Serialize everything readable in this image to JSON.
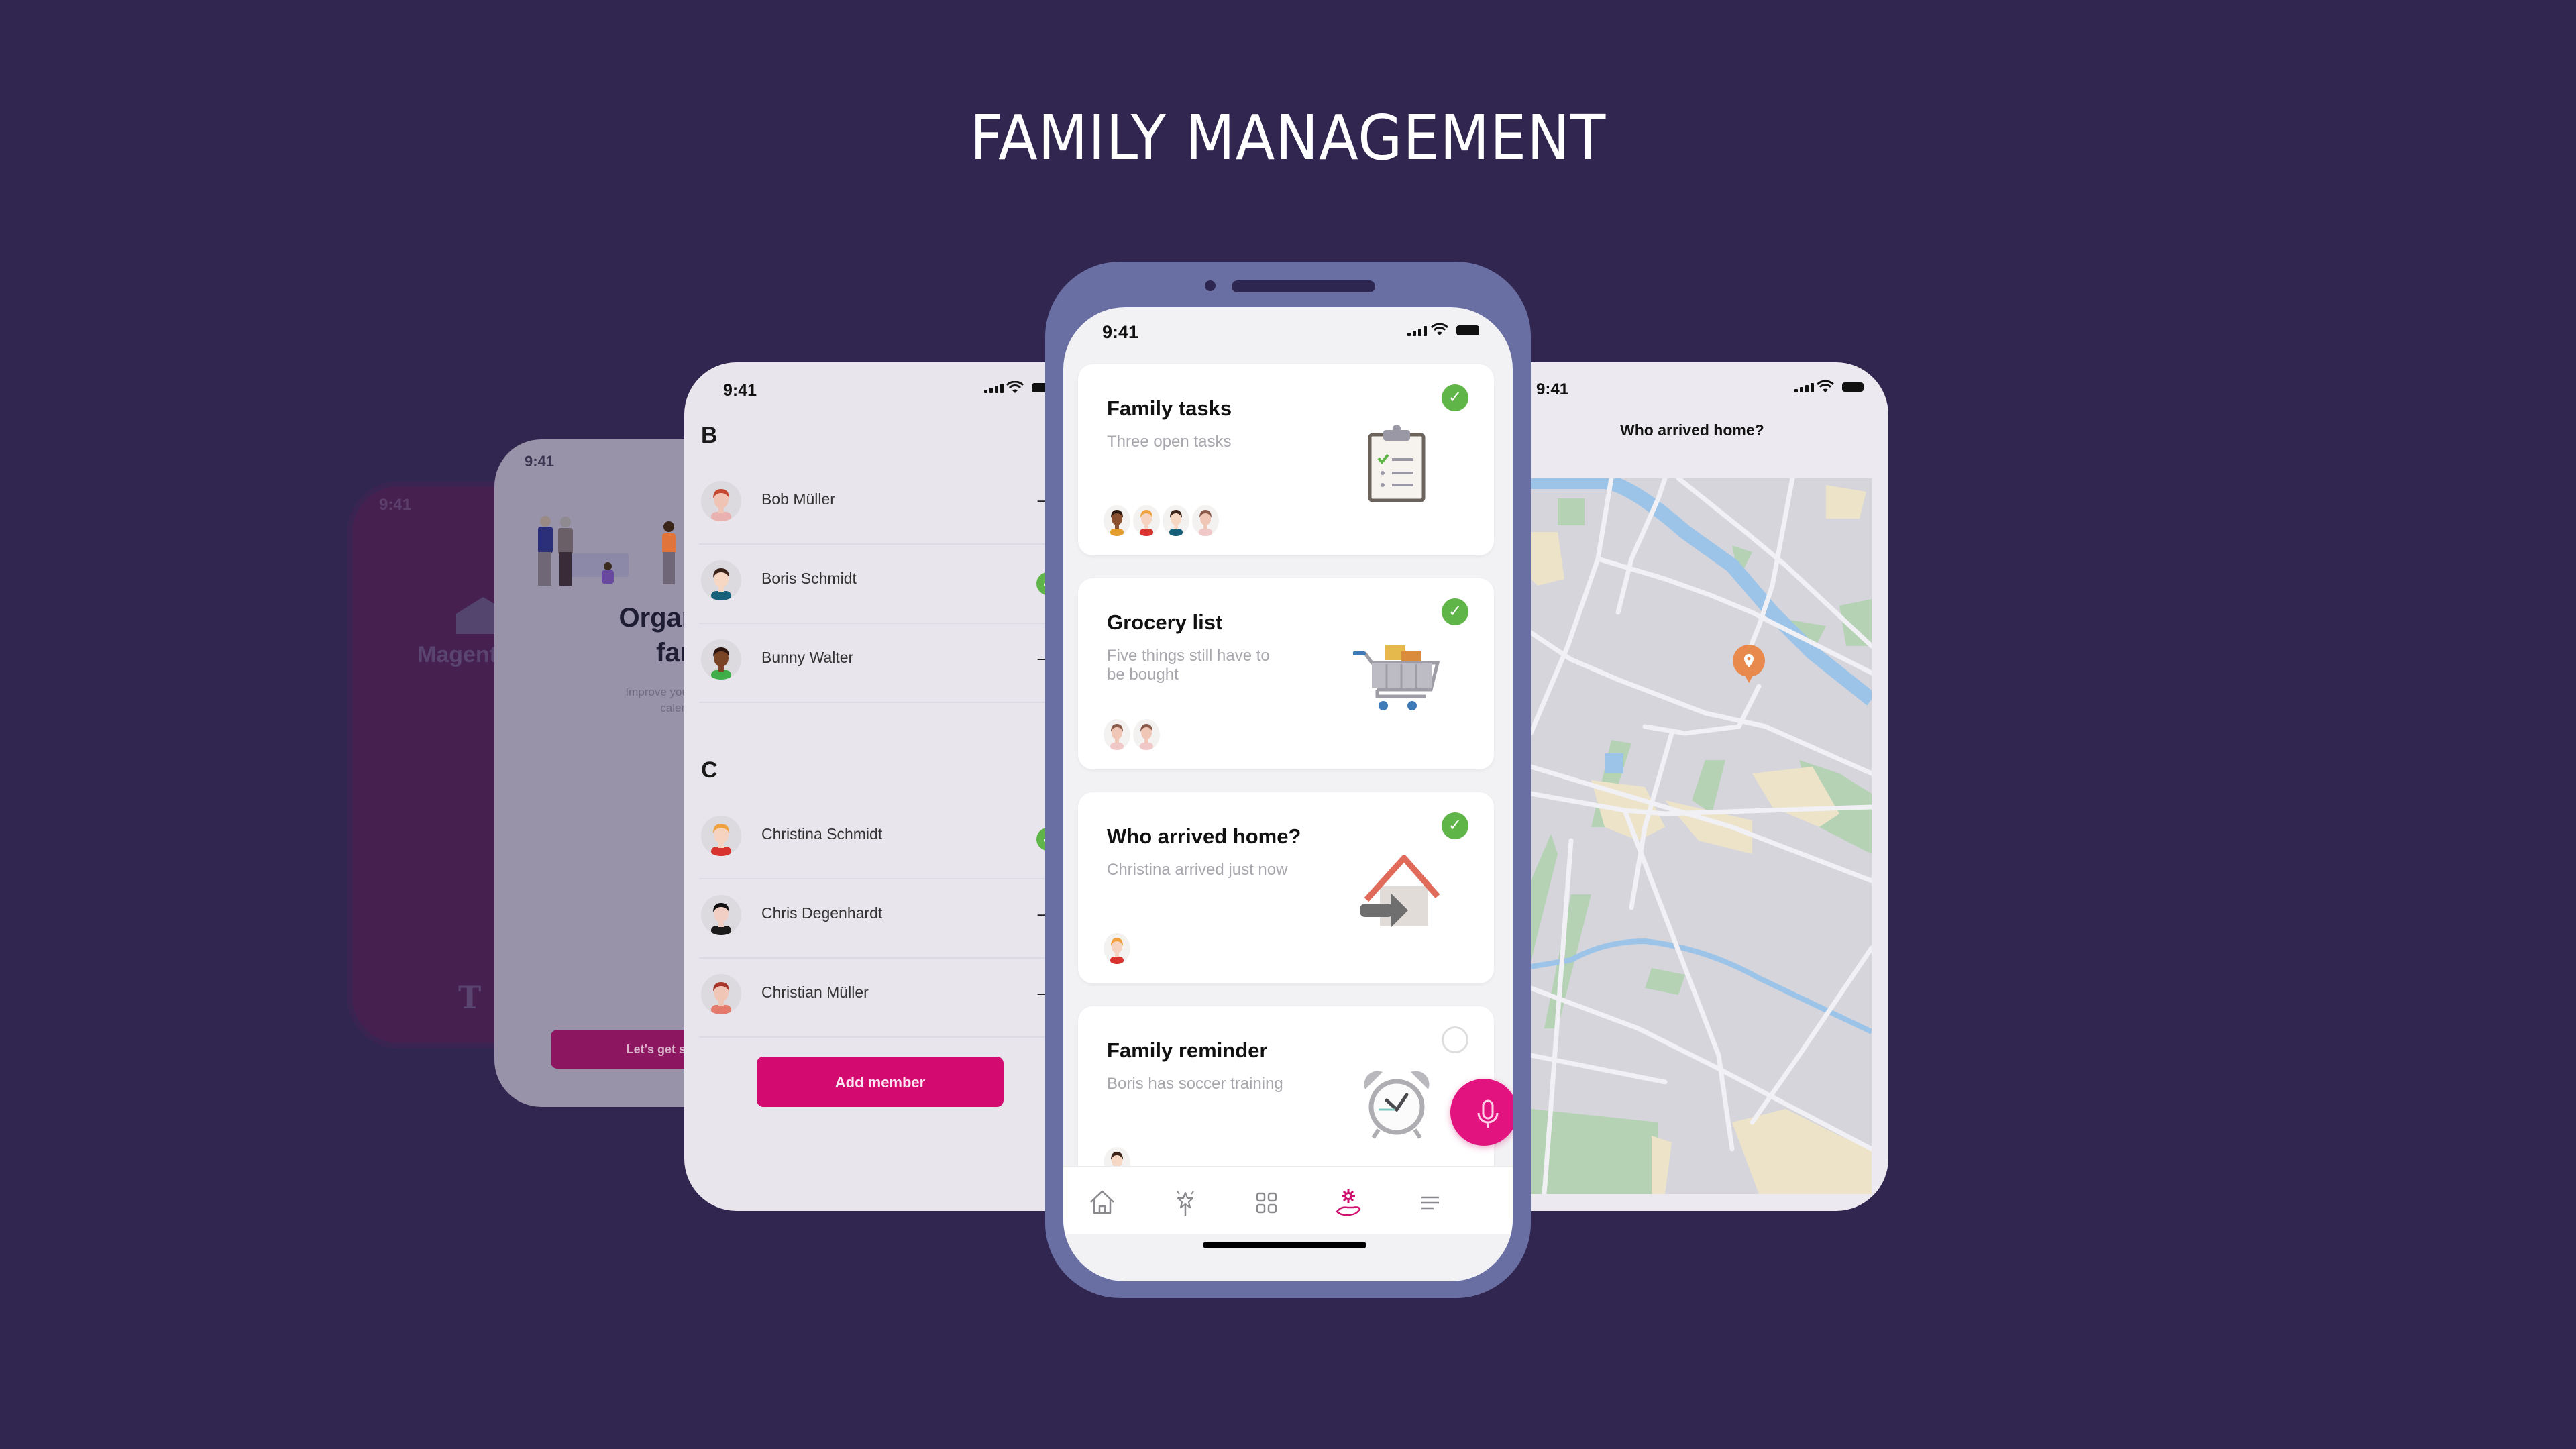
{
  "page": {
    "title": "FAMILY MANAGEMENT",
    "colors": {
      "background": "#31264f",
      "phone_frame": "#6a6fa3",
      "magenta": "#e2137f",
      "success_green": "#5fb548"
    }
  },
  "splash_screen": {
    "time": "9:41",
    "brand": "MagentaZ",
    "logo": "T"
  },
  "onboarding_screen": {
    "time": "9:41",
    "headline_line1": "Organize y",
    "headline_line2": "family li",
    "subtitle_line1": "Improve your family and s",
    "subtitle_line2": "calenders and loca",
    "cta_label": "Let's get starte"
  },
  "contacts_screen": {
    "time": "9:41",
    "sections": [
      {
        "letter": "B",
        "contacts": [
          {
            "name": "Bob Müller",
            "status": "add",
            "avatar": "red-haired-man"
          },
          {
            "name": "Boris Schmidt",
            "status": "added",
            "avatar": "dark-haired-man"
          },
          {
            "name": "Bunny Walter",
            "status": "add",
            "avatar": "woman-bun"
          }
        ]
      },
      {
        "letter": "C",
        "contacts": [
          {
            "name": "Christina Schmidt",
            "status": "added",
            "avatar": "blonde-woman"
          },
          {
            "name": "Chris Degenhardt",
            "status": "add",
            "avatar": "black-haired-person"
          },
          {
            "name": "Christian Müller",
            "status": "add",
            "avatar": "redhead-woman"
          }
        ]
      }
    ],
    "add_member_label": "Add member",
    "add_glyph": "+",
    "check_glyph": "✓"
  },
  "dashboard_screen": {
    "time": "9:41",
    "cards": [
      {
        "title": "Family tasks",
        "subtitle": "Three open tasks",
        "done": true,
        "illustration": "clipboard-icon",
        "avatars": 4
      },
      {
        "title": "Grocery list",
        "subtitle": "Five things still have to be bought",
        "done": true,
        "illustration": "shopping-cart-icon",
        "avatars": 2
      },
      {
        "title": "Who arrived home?",
        "subtitle": "Christina arrived just now",
        "done": true,
        "illustration": "house-arrow-icon",
        "avatars": 1
      },
      {
        "title": "Family reminder",
        "subtitle": "Boris has soccer training",
        "done": false,
        "illustration": "alarm-clock-icon",
        "avatars": 1
      }
    ],
    "tabs": [
      {
        "name": "home",
        "active": false
      },
      {
        "name": "magic",
        "active": false
      },
      {
        "name": "apps",
        "active": false
      },
      {
        "name": "family-care",
        "active": true
      },
      {
        "name": "menu",
        "active": false
      }
    ],
    "check_glyph": "✓"
  },
  "map_screen": {
    "time": "9:41",
    "title": "Who arrived home?"
  }
}
